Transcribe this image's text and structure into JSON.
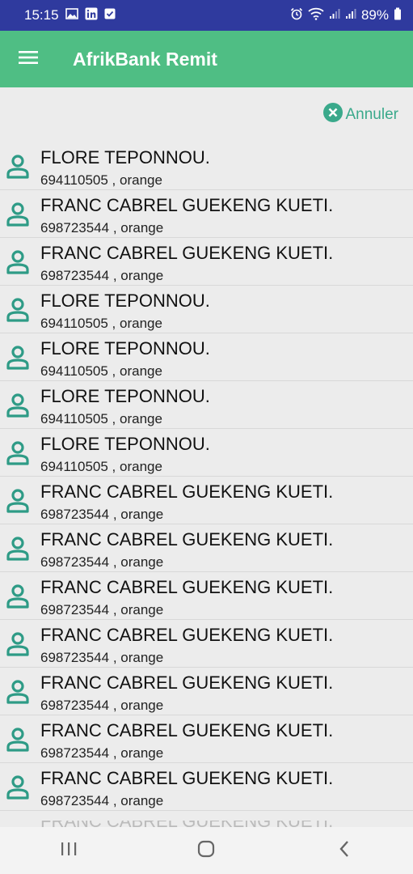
{
  "status_bar": {
    "time": "15:15",
    "battery": "89%",
    "left_icons": [
      "image-icon",
      "linkedin-icon",
      "download-check-icon"
    ],
    "right_icons": [
      "alarm-icon",
      "wifi-icon",
      "signal-icon",
      "signal-icon",
      "battery-icon"
    ]
  },
  "app_bar": {
    "title": "AfrikBank Remit",
    "menu_icon": "menu-icon",
    "color": "#4fbe84"
  },
  "actions": {
    "cancel_label": "Annuler",
    "cancel_color": "#3aa98b"
  },
  "contacts": [
    {
      "name": "FLORE TEPONNOU.",
      "detail": "694110505 , orange"
    },
    {
      "name": "FRANC CABREL GUEKENG KUETI.",
      "detail": "698723544 , orange"
    },
    {
      "name": "FRANC CABREL GUEKENG KUETI.",
      "detail": "698723544 , orange"
    },
    {
      "name": "FLORE TEPONNOU.",
      "detail": "694110505 , orange"
    },
    {
      "name": "FLORE TEPONNOU.",
      "detail": "694110505 , orange"
    },
    {
      "name": "FLORE TEPONNOU.",
      "detail": "694110505 , orange"
    },
    {
      "name": "FLORE TEPONNOU.",
      "detail": "694110505 , orange"
    },
    {
      "name": "FRANC CABREL GUEKENG KUETI.",
      "detail": "698723544 , orange"
    },
    {
      "name": "FRANC CABREL GUEKENG KUETI.",
      "detail": "698723544 , orange"
    },
    {
      "name": "FRANC CABREL GUEKENG KUETI.",
      "detail": "698723544 , orange"
    },
    {
      "name": "FRANC CABREL GUEKENG KUETI.",
      "detail": "698723544 , orange"
    },
    {
      "name": "FRANC CABREL GUEKENG KUETI.",
      "detail": "698723544 , orange"
    },
    {
      "name": "FRANC CABREL GUEKENG KUETI.",
      "detail": "698723544 , orange"
    },
    {
      "name": "FRANC CABREL GUEKENG KUETI.",
      "detail": "698723544 , orange"
    }
  ],
  "partial_contact": {
    "name": "FRANC CABREL GUEKENG KUETI."
  },
  "nav_bar": {
    "buttons": [
      "recent-apps-icon",
      "home-icon",
      "back-icon"
    ]
  },
  "colors": {
    "status_bar": "#2f3a9e",
    "person_icon": "#2e9b86"
  }
}
